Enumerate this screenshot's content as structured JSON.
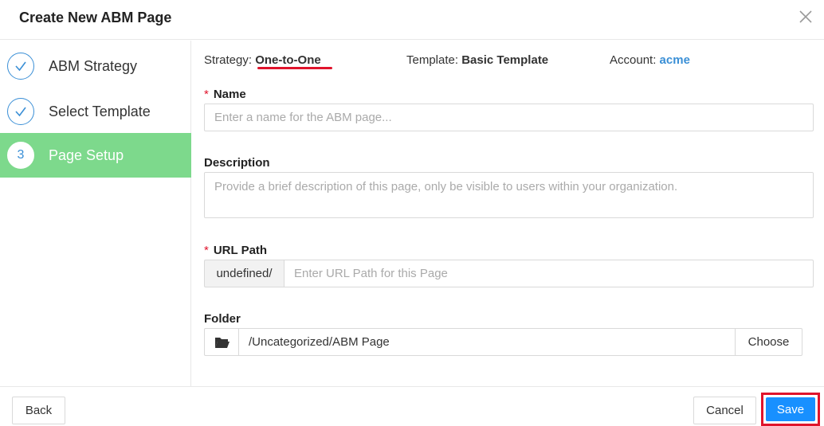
{
  "dialog": {
    "title": "Create New ABM Page"
  },
  "steps": [
    {
      "label": "ABM Strategy",
      "state": "done"
    },
    {
      "label": "Select Template",
      "state": "done"
    },
    {
      "label": "Page Setup",
      "state": "active",
      "number": "3"
    }
  ],
  "meta": {
    "strategy_label": "Strategy:",
    "strategy_value": "One-to-One",
    "template_label": "Template:",
    "template_value": "Basic Template",
    "account_label": "Account:",
    "account_value": "acme"
  },
  "form": {
    "required_mark": "*",
    "name_label": "Name",
    "name_placeholder": "Enter a name for the ABM page...",
    "name_value": "",
    "description_label": "Description",
    "description_placeholder": "Provide a brief description of this page, only be visible to users within your organization.",
    "description_value": "",
    "url_label": "URL Path",
    "url_prefix": "undefined/",
    "url_placeholder": "Enter URL Path for this Page",
    "url_value": "",
    "folder_label": "Folder",
    "folder_value": "/Uncategorized/ABM Page",
    "choose_label": "Choose"
  },
  "footer": {
    "back_label": "Back",
    "cancel_label": "Cancel",
    "save_label": "Save"
  },
  "colors": {
    "accent": "#3a8fd6",
    "active_step": "#7dd98c",
    "primary_button": "#1890ff",
    "highlight": "#e0142c"
  }
}
